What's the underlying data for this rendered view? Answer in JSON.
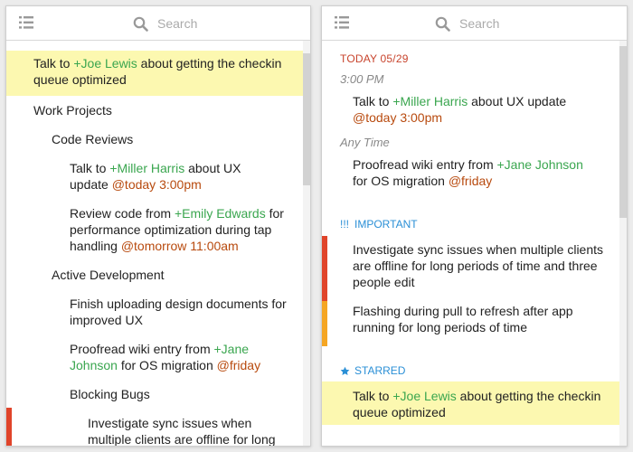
{
  "search": {
    "placeholder": "Search"
  },
  "left": {
    "highlighted": {
      "prefix": "Talk to ",
      "contact": "+Joe Lewis",
      "suffix": " about getting the checkin queue optimized"
    },
    "work_projects": "Work Projects",
    "code_reviews": "Code Reviews",
    "task1": {
      "prefix": "Talk to ",
      "contact": "+Miller Harris",
      "mid": " about UX update ",
      "tag": "@today 3:00pm"
    },
    "task2": {
      "prefix": "Review code from ",
      "contact": "+Emily Edwards",
      "mid": " for performance optimization during tap handling ",
      "tag": "@tomorrow 11:00am"
    },
    "active_development": "Active Development",
    "task3": {
      "text": "Finish uploading design documents for improved UX"
    },
    "task4": {
      "prefix": "Proofread wiki entry from ",
      "contact": "+Jane Johnson",
      "mid": " for OS migration ",
      "tag": "@friday"
    },
    "blocking_bugs": "Blocking Bugs",
    "task5": {
      "text": "Investigate sync issues when multiple clients are offline for long"
    }
  },
  "right": {
    "today": "TODAY 05/29",
    "time1": "3:00 PM",
    "task1": {
      "prefix": "Talk to ",
      "contact": "+Miller Harris",
      "mid": " about UX update ",
      "tag": "@today 3:00pm"
    },
    "time2": "Any Time",
    "task2": {
      "prefix": "Proofread wiki entry from ",
      "contact": "+Jane Johnson",
      "mid": " for OS migration ",
      "tag": "@friday"
    },
    "important_mark": "!!!",
    "important": "IMPORTANT",
    "task3": {
      "text": "Investigate sync issues when multiple clients are offline for long periods of time and three people edit"
    },
    "task4": {
      "text": "Flashing during pull to refresh after app running for long periods of time"
    },
    "starred": "STARRED",
    "task5": {
      "prefix": "Talk to ",
      "contact": "+Joe Lewis",
      "suffix": " about getting the checkin queue optimized"
    }
  },
  "colors": {
    "contact": "#3aa64f",
    "tag": "#b84a0e",
    "highlight": "#fcf8b0",
    "priority_high": "#e0442a",
    "priority_medium": "#f5a623",
    "section": "#2a8fd6",
    "date": "#c8442d"
  }
}
